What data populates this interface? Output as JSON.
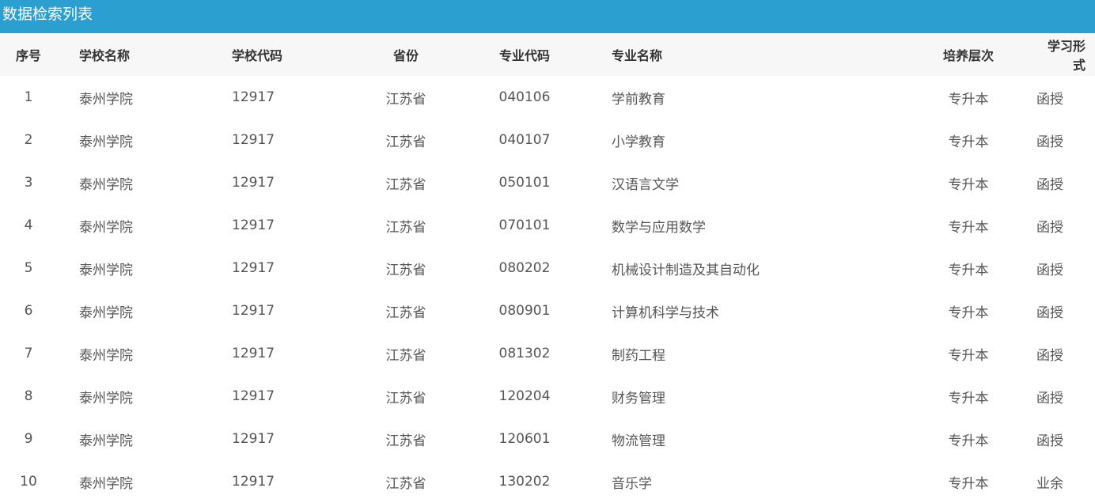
{
  "panel": {
    "title": "数据检索列表"
  },
  "table": {
    "headers": {
      "seq": "序号",
      "school_name": "学校名称",
      "school_code": "学校代码",
      "province": "省份",
      "major_code": "专业代码",
      "major_name": "专业名称",
      "level": "培养层次",
      "study_form": "学习形式"
    },
    "rows": [
      {
        "seq": "1",
        "school_name": "泰州学院",
        "school_code": "12917",
        "province": "江苏省",
        "major_code": "040106",
        "major_name": "学前教育",
        "level": "专升本",
        "study_form": "函授"
      },
      {
        "seq": "2",
        "school_name": "泰州学院",
        "school_code": "12917",
        "province": "江苏省",
        "major_code": "040107",
        "major_name": "小学教育",
        "level": "专升本",
        "study_form": "函授"
      },
      {
        "seq": "3",
        "school_name": "泰州学院",
        "school_code": "12917",
        "province": "江苏省",
        "major_code": "050101",
        "major_name": "汉语言文学",
        "level": "专升本",
        "study_form": "函授"
      },
      {
        "seq": "4",
        "school_name": "泰州学院",
        "school_code": "12917",
        "province": "江苏省",
        "major_code": "070101",
        "major_name": "数学与应用数学",
        "level": "专升本",
        "study_form": "函授"
      },
      {
        "seq": "5",
        "school_name": "泰州学院",
        "school_code": "12917",
        "province": "江苏省",
        "major_code": "080202",
        "major_name": "机械设计制造及其自动化",
        "level": "专升本",
        "study_form": "函授"
      },
      {
        "seq": "6",
        "school_name": "泰州学院",
        "school_code": "12917",
        "province": "江苏省",
        "major_code": "080901",
        "major_name": "计算机科学与技术",
        "level": "专升本",
        "study_form": "函授"
      },
      {
        "seq": "7",
        "school_name": "泰州学院",
        "school_code": "12917",
        "province": "江苏省",
        "major_code": "081302",
        "major_name": "制药工程",
        "level": "专升本",
        "study_form": "函授"
      },
      {
        "seq": "8",
        "school_name": "泰州学院",
        "school_code": "12917",
        "province": "江苏省",
        "major_code": "120204",
        "major_name": "财务管理",
        "level": "专升本",
        "study_form": "函授"
      },
      {
        "seq": "9",
        "school_name": "泰州学院",
        "school_code": "12917",
        "province": "江苏省",
        "major_code": "120601",
        "major_name": "物流管理",
        "level": "专升本",
        "study_form": "函授"
      },
      {
        "seq": "10",
        "school_name": "泰州学院",
        "school_code": "12917",
        "province": "江苏省",
        "major_code": "130202",
        "major_name": "音乐学",
        "level": "专升本",
        "study_form": "业余"
      }
    ]
  },
  "colors": {
    "header_bar": "#2a9fd0",
    "table_head_bg": "#f7f7f7",
    "text": "#555555"
  }
}
